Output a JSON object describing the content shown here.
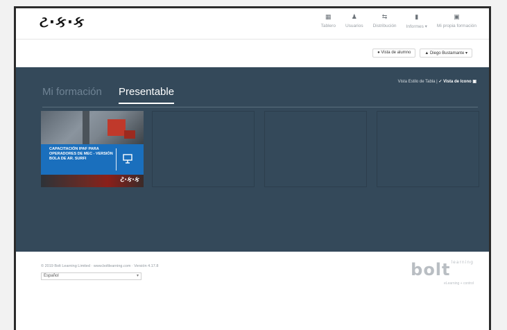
{
  "brand": {
    "logo_text": "ટ·ક·ક"
  },
  "nav": {
    "items": [
      {
        "label": "Tablero",
        "icon": "dashboard-icon",
        "glyph": "▦"
      },
      {
        "label": "Usuarios",
        "icon": "users-icon",
        "glyph": "♟"
      },
      {
        "label": "Distribución",
        "icon": "distribution-icon",
        "glyph": "⇆"
      },
      {
        "label": "Informes ▾",
        "icon": "reports-icon",
        "glyph": "▮"
      },
      {
        "label": "Mi propia formación",
        "icon": "training-icon",
        "glyph": "▣"
      }
    ]
  },
  "subbar": {
    "preview_button": "● Vista de alumno",
    "user_button": "▲ Diego Bustamante ▾"
  },
  "main": {
    "view_toggle_prefix": "Vista Estilo de Tabla | ",
    "view_toggle_active": "✓ Vista de Icono ▣",
    "tabs": [
      {
        "label": "Mi formación",
        "active": false
      },
      {
        "label": "Presentable",
        "active": true
      }
    ],
    "course_card": {
      "title": "CAPACITACIÓN IPAF PARA OPERADORES DE MEC - VERSIÓN BOLA DE AR. SURFI",
      "logo": "ટ·ક·ક"
    }
  },
  "footer": {
    "copyright": "© 2019 Bolt Learning Limited · www.boltlearning.com · Versión 4.17.8",
    "language_value": "Español",
    "brand_name": "bolt",
    "brand_super": "learning",
    "brand_tagline": "eLearning + control"
  },
  "colors": {
    "main_bg": "#34495a",
    "banner_blue": "#1a6fbd",
    "accent_red": "#c0392b"
  }
}
